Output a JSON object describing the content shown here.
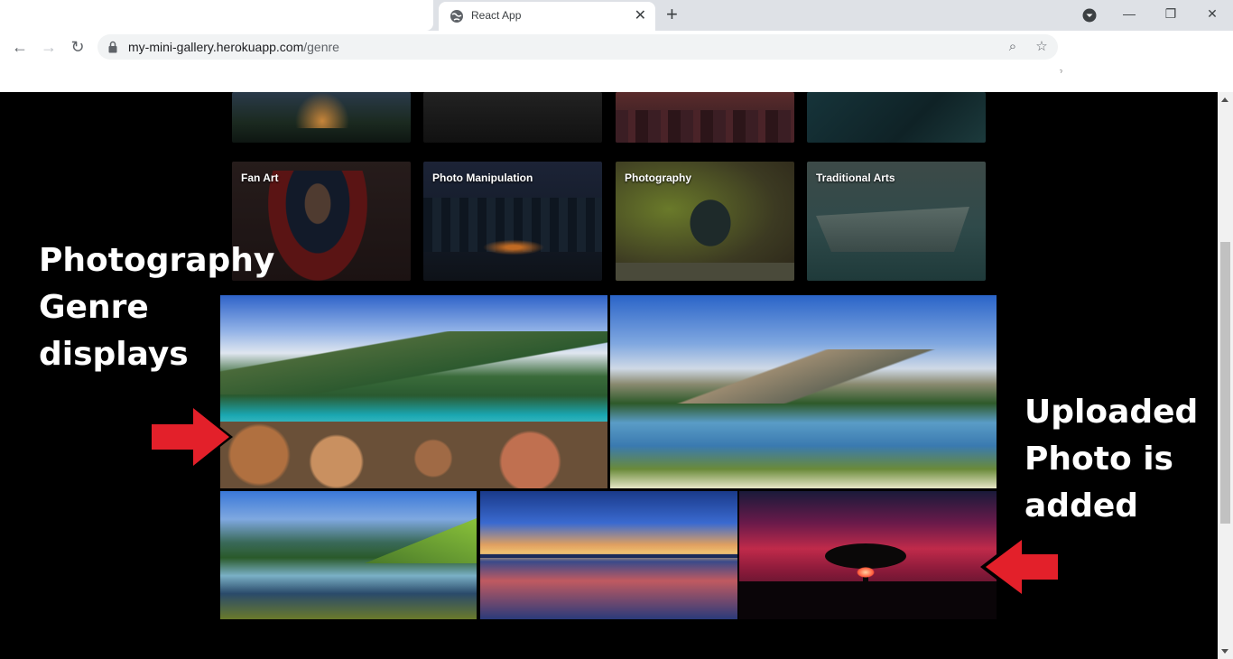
{
  "browser": {
    "tab_title": "React App",
    "new_tab": "+",
    "close_tab": "✕",
    "url_host": "my-mini-gallery.herokuapp.com",
    "url_path": "/genre",
    "window_controls": {
      "minimize": "—",
      "restore": "❐",
      "close": "✕"
    },
    "nav": {
      "back": "←",
      "forward": "→",
      "reload": "↻"
    },
    "omni_icons": {
      "zoom": "⌕",
      "star": "☆"
    }
  },
  "genres_top": [
    {
      "label": ""
    },
    {
      "label": ""
    },
    {
      "label": ""
    },
    {
      "label": ""
    }
  ],
  "genres": [
    {
      "label": "Fan Art"
    },
    {
      "label": "Photo Manipulation"
    },
    {
      "label": "Photography"
    },
    {
      "label": "Traditional Arts"
    }
  ],
  "annotations": {
    "left": [
      "Photography",
      "Genre",
      "displays"
    ],
    "right": [
      "Uploaded",
      "Photo is",
      "added"
    ],
    "arrow_color": "#e3202a"
  },
  "photos": [
    {
      "name": "mountain-lake-rocks"
    },
    {
      "name": "alpine-lake-reflection"
    },
    {
      "name": "forest-valley-lake"
    },
    {
      "name": "ocean-sunset"
    },
    {
      "name": "red-sky-tree"
    }
  ]
}
